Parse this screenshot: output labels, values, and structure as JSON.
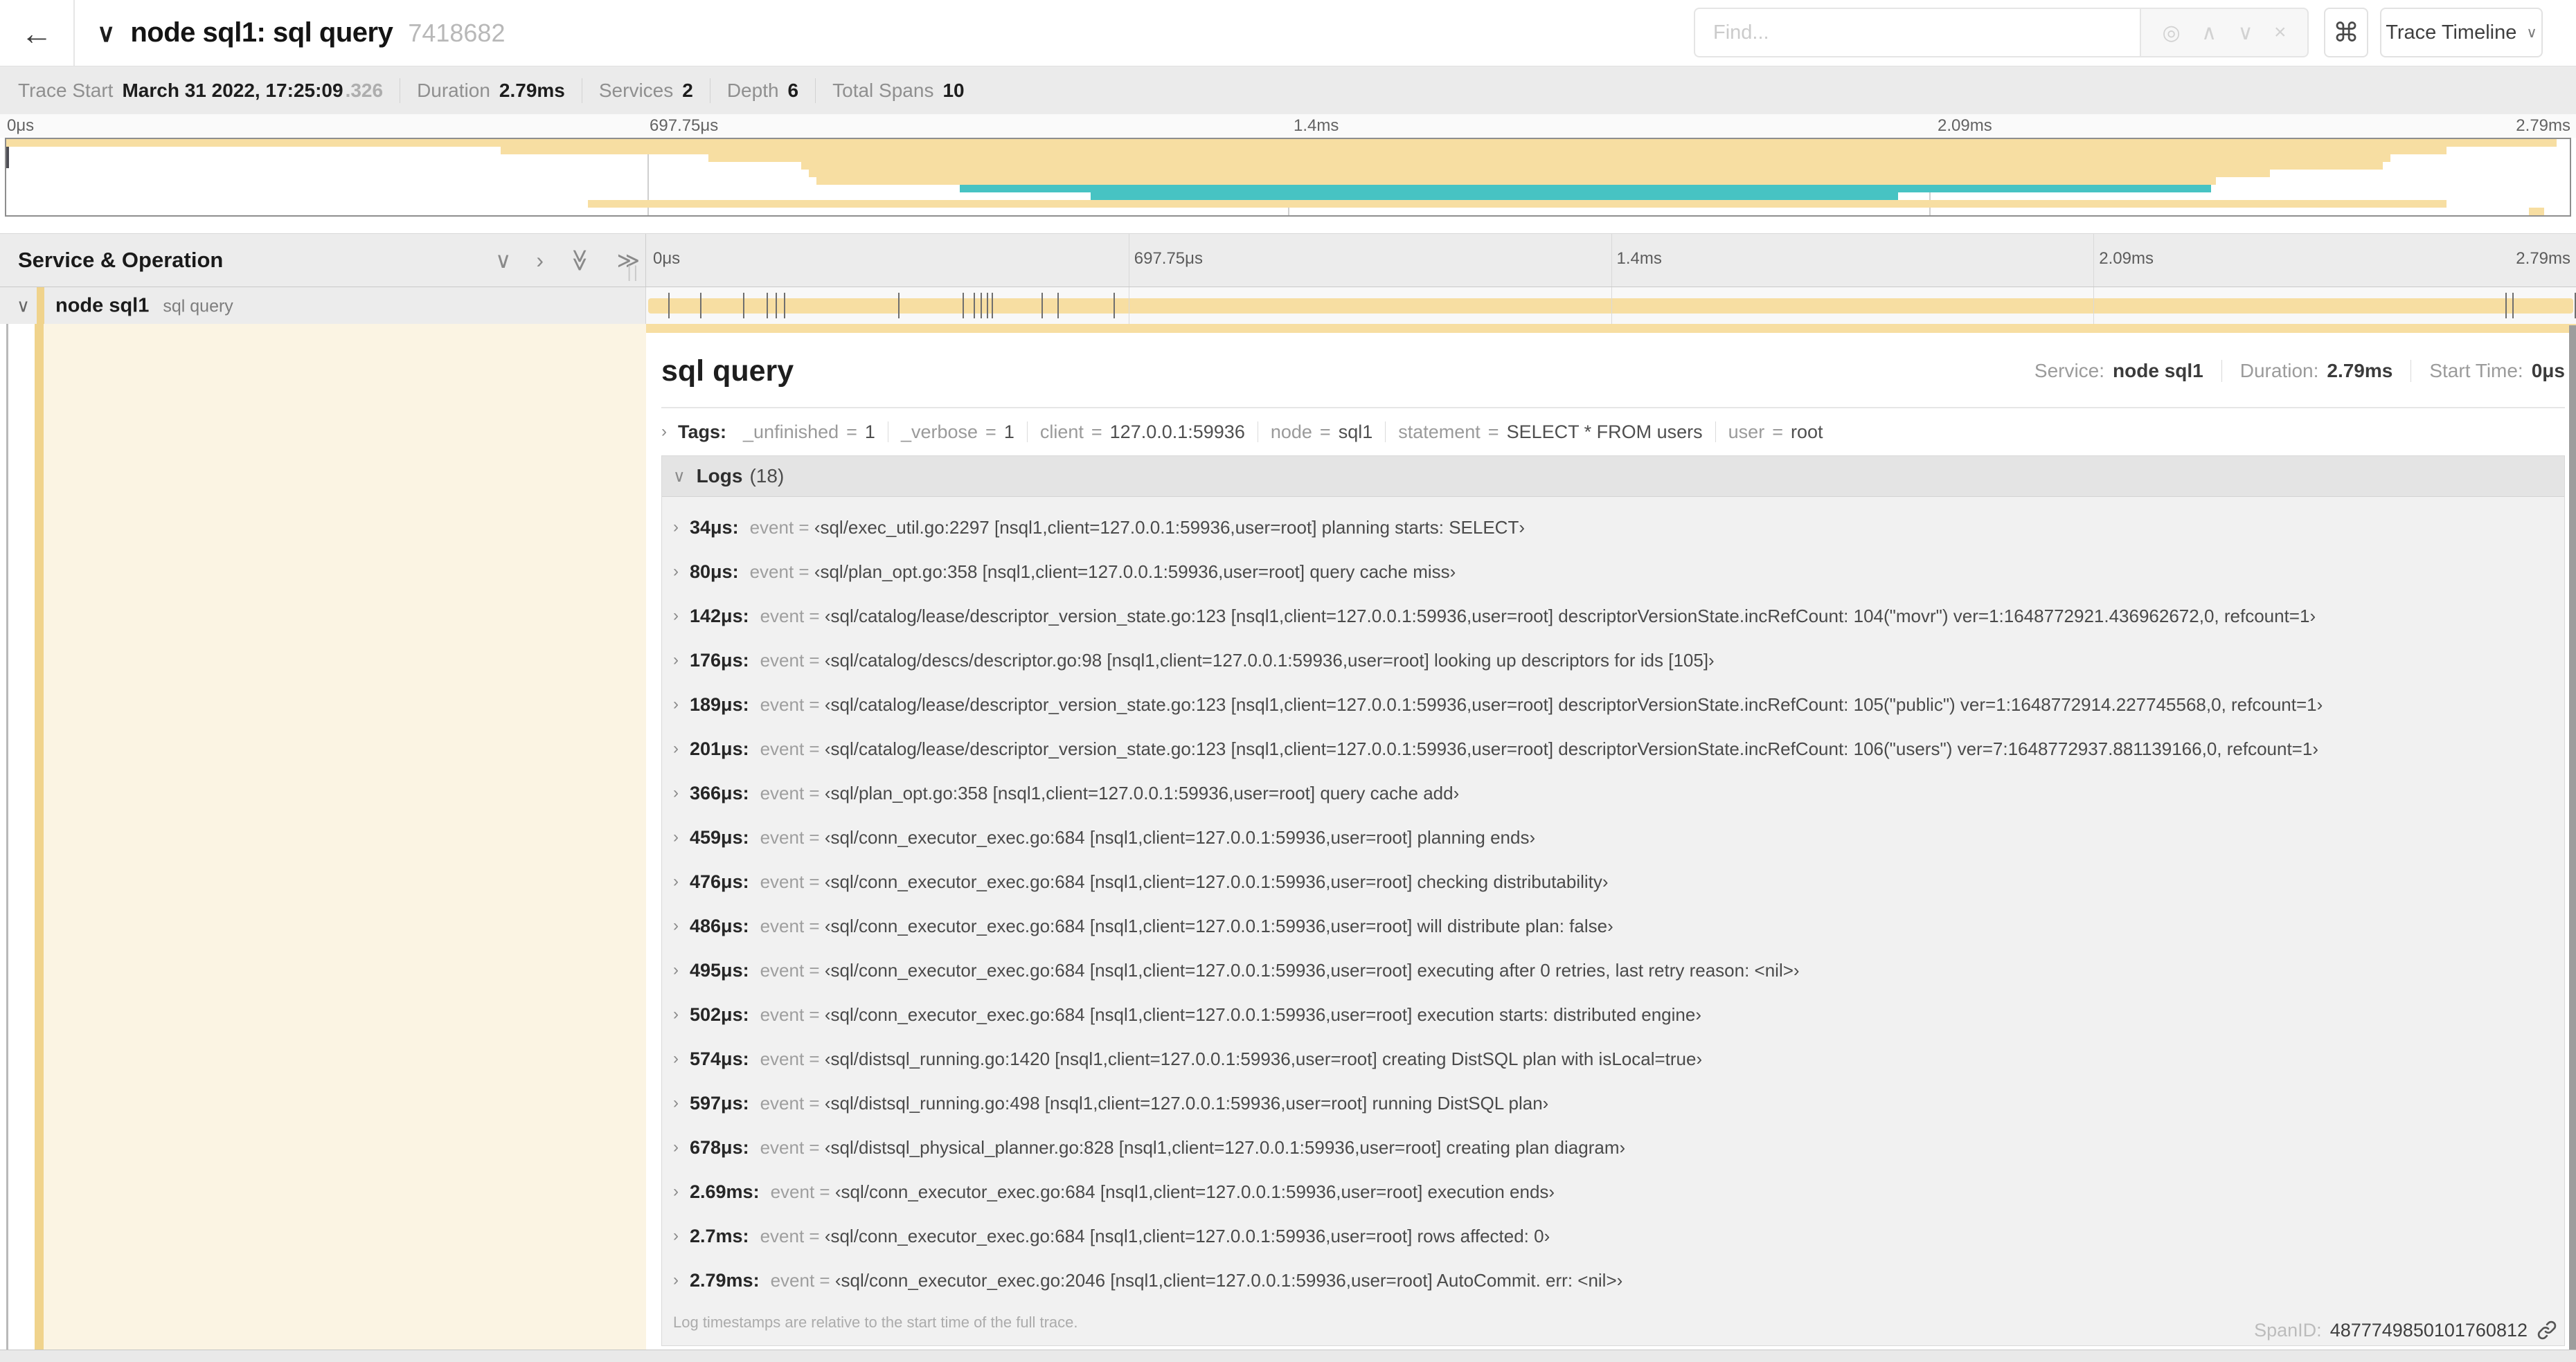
{
  "colors": {
    "tan": "#F7DEA2",
    "accent": "#F0D38C",
    "cream": "#FBF4E3",
    "teal": "#47C3C3"
  },
  "header": {
    "back_icon": "←",
    "collapse_icon": "∨",
    "title": "node sql1: sql query",
    "trace_id_short": "7418682",
    "find_placeholder": "Find...",
    "find_buttons": [
      {
        "name": "locate",
        "glyph": "◎"
      },
      {
        "name": "previous-result",
        "glyph": "∧"
      },
      {
        "name": "next-result",
        "glyph": "∨"
      },
      {
        "name": "clear-search",
        "glyph": "×"
      }
    ],
    "shortcut_icon": "⌘",
    "view_selector": "Trace Timeline",
    "view_caret": "∨"
  },
  "trace_meta": {
    "items": [
      {
        "label": "Trace Start",
        "value": "March 31 2022, 17:25:09",
        "suffix": ".326"
      },
      {
        "label": "Duration",
        "value": "2.79ms"
      },
      {
        "label": "Services",
        "value": "2"
      },
      {
        "label": "Depth",
        "value": "6"
      },
      {
        "label": "Total Spans",
        "value": "10"
      }
    ]
  },
  "timeline": {
    "duration_us": 2790,
    "labels": [
      {
        "text": "0μs",
        "pct": 0
      },
      {
        "text": "697.75μs",
        "pct": 25
      },
      {
        "text": "1.4ms",
        "pct": 50
      },
      {
        "text": "2.09ms",
        "pct": 75
      },
      {
        "text": "2.79ms",
        "pct": 100
      }
    ],
    "gridline_pcts": [
      25,
      50,
      75
    ]
  },
  "minimap": {
    "spans": [
      {
        "start": 0,
        "end": 99.5,
        "color": "tan"
      },
      {
        "start": 19.3,
        "end": 95.2,
        "color": "tan"
      },
      {
        "start": 27.4,
        "end": 93.0,
        "color": "tan"
      },
      {
        "start": 31.0,
        "end": 92.7,
        "color": "tan"
      },
      {
        "start": 31.3,
        "end": 88.3,
        "color": "tan"
      },
      {
        "start": 31.6,
        "end": 86.2,
        "color": "tan"
      },
      {
        "start": 37.2,
        "end": 86.0,
        "color": "teal"
      },
      {
        "start": 42.3,
        "end": 73.8,
        "color": "teal"
      },
      {
        "start": 22.7,
        "end": 95.2,
        "color": "tan"
      },
      {
        "start": 98.4,
        "end": 99.0,
        "color": "tan"
      }
    ]
  },
  "columns": {
    "left_header": "Service & Operation",
    "controls": [
      {
        "name": "collapse-one",
        "glyph": "∨",
        "rotate": false
      },
      {
        "name": "expand-one",
        "glyph": "›",
        "rotate": false
      },
      {
        "name": "collapse-all",
        "glyph": "≫",
        "rotate": true
      },
      {
        "name": "expand-all",
        "glyph": "≫",
        "rotate": false
      }
    ],
    "resizer_glyph": "||"
  },
  "span_row": {
    "chevron": "∨",
    "service": "node sql1",
    "operation": "sql query",
    "log_marker_times_us": [
      34,
      80,
      142,
      176,
      189,
      201,
      366,
      459,
      476,
      486,
      495,
      502,
      574,
      597,
      678,
      2690,
      2700,
      2790
    ]
  },
  "detail": {
    "title": "sql query",
    "summary": [
      {
        "label": "Service:",
        "value": "node sql1"
      },
      {
        "label": "Duration:",
        "value": "2.79ms"
      },
      {
        "label": "Start Time:",
        "value": "0μs"
      }
    ],
    "tags_chevron": "›",
    "tags_label": "Tags:",
    "tags": [
      {
        "key": "_unfinished",
        "value": "1"
      },
      {
        "key": "_verbose",
        "value": "1"
      },
      {
        "key": "client",
        "value": "127.0.0.1:59936"
      },
      {
        "key": "node",
        "value": "sql1"
      },
      {
        "key": "statement",
        "value": "SELECT * FROM users"
      },
      {
        "key": "user",
        "value": "root"
      }
    ],
    "logs_chevron": "∨",
    "logs_label": "Logs",
    "logs_count": "(18)",
    "log_field_key": "event",
    "logs": [
      {
        "time": "34μs:",
        "value": "‹sql/exec_util.go:2297 [nsql1,client=127.0.0.1:59936,user=root] planning starts: SELECT›"
      },
      {
        "time": "80μs:",
        "value": "‹sql/plan_opt.go:358 [nsql1,client=127.0.0.1:59936,user=root] query cache miss›"
      },
      {
        "time": "142μs:",
        "value": "‹sql/catalog/lease/descriptor_version_state.go:123 [nsql1,client=127.0.0.1:59936,user=root] descriptorVersionState.incRefCount: 104(\"movr\") ver=1:1648772921.436962672,0, refcount=1›"
      },
      {
        "time": "176μs:",
        "value": "‹sql/catalog/descs/descriptor.go:98 [nsql1,client=127.0.0.1:59936,user=root] looking up descriptors for ids [105]›"
      },
      {
        "time": "189μs:",
        "value": "‹sql/catalog/lease/descriptor_version_state.go:123 [nsql1,client=127.0.0.1:59936,user=root] descriptorVersionState.incRefCount: 105(\"public\") ver=1:1648772914.227745568,0, refcount=1›"
      },
      {
        "time": "201μs:",
        "value": "‹sql/catalog/lease/descriptor_version_state.go:123 [nsql1,client=127.0.0.1:59936,user=root] descriptorVersionState.incRefCount: 106(\"users\") ver=7:1648772937.881139166,0, refcount=1›"
      },
      {
        "time": "366μs:",
        "value": "‹sql/plan_opt.go:358 [nsql1,client=127.0.0.1:59936,user=root] query cache add›"
      },
      {
        "time": "459μs:",
        "value": "‹sql/conn_executor_exec.go:684 [nsql1,client=127.0.0.1:59936,user=root] planning ends›"
      },
      {
        "time": "476μs:",
        "value": "‹sql/conn_executor_exec.go:684 [nsql1,client=127.0.0.1:59936,user=root] checking distributability›"
      },
      {
        "time": "486μs:",
        "value": "‹sql/conn_executor_exec.go:684 [nsql1,client=127.0.0.1:59936,user=root] will distribute plan: false›"
      },
      {
        "time": "495μs:",
        "value": "‹sql/conn_executor_exec.go:684 [nsql1,client=127.0.0.1:59936,user=root] executing after 0 retries, last retry reason: <nil>›"
      },
      {
        "time": "502μs:",
        "value": "‹sql/conn_executor_exec.go:684 [nsql1,client=127.0.0.1:59936,user=root] execution starts: distributed engine›"
      },
      {
        "time": "574μs:",
        "value": "‹sql/distsql_running.go:1420 [nsql1,client=127.0.0.1:59936,user=root] creating DistSQL plan with isLocal=true›"
      },
      {
        "time": "597μs:",
        "value": "‹sql/distsql_running.go:498 [nsql1,client=127.0.0.1:59936,user=root] running DistSQL plan›"
      },
      {
        "time": "678μs:",
        "value": "‹sql/distsql_physical_planner.go:828 [nsql1,client=127.0.0.1:59936,user=root] creating plan diagram›"
      },
      {
        "time": "2.69ms:",
        "value": "‹sql/conn_executor_exec.go:684 [nsql1,client=127.0.0.1:59936,user=root] execution ends›"
      },
      {
        "time": "2.7ms:",
        "value": "‹sql/conn_executor_exec.go:684 [nsql1,client=127.0.0.1:59936,user=root] rows affected: 0›"
      },
      {
        "time": "2.79ms:",
        "value": "‹sql/conn_executor_exec.go:2046 [nsql1,client=127.0.0.1:59936,user=root] AutoCommit. err: <nil>›"
      }
    ],
    "logs_note": "Log timestamps are relative to the start time of the full trace.",
    "span_id_label": "SpanID:",
    "span_id": "4877749850101760812"
  }
}
